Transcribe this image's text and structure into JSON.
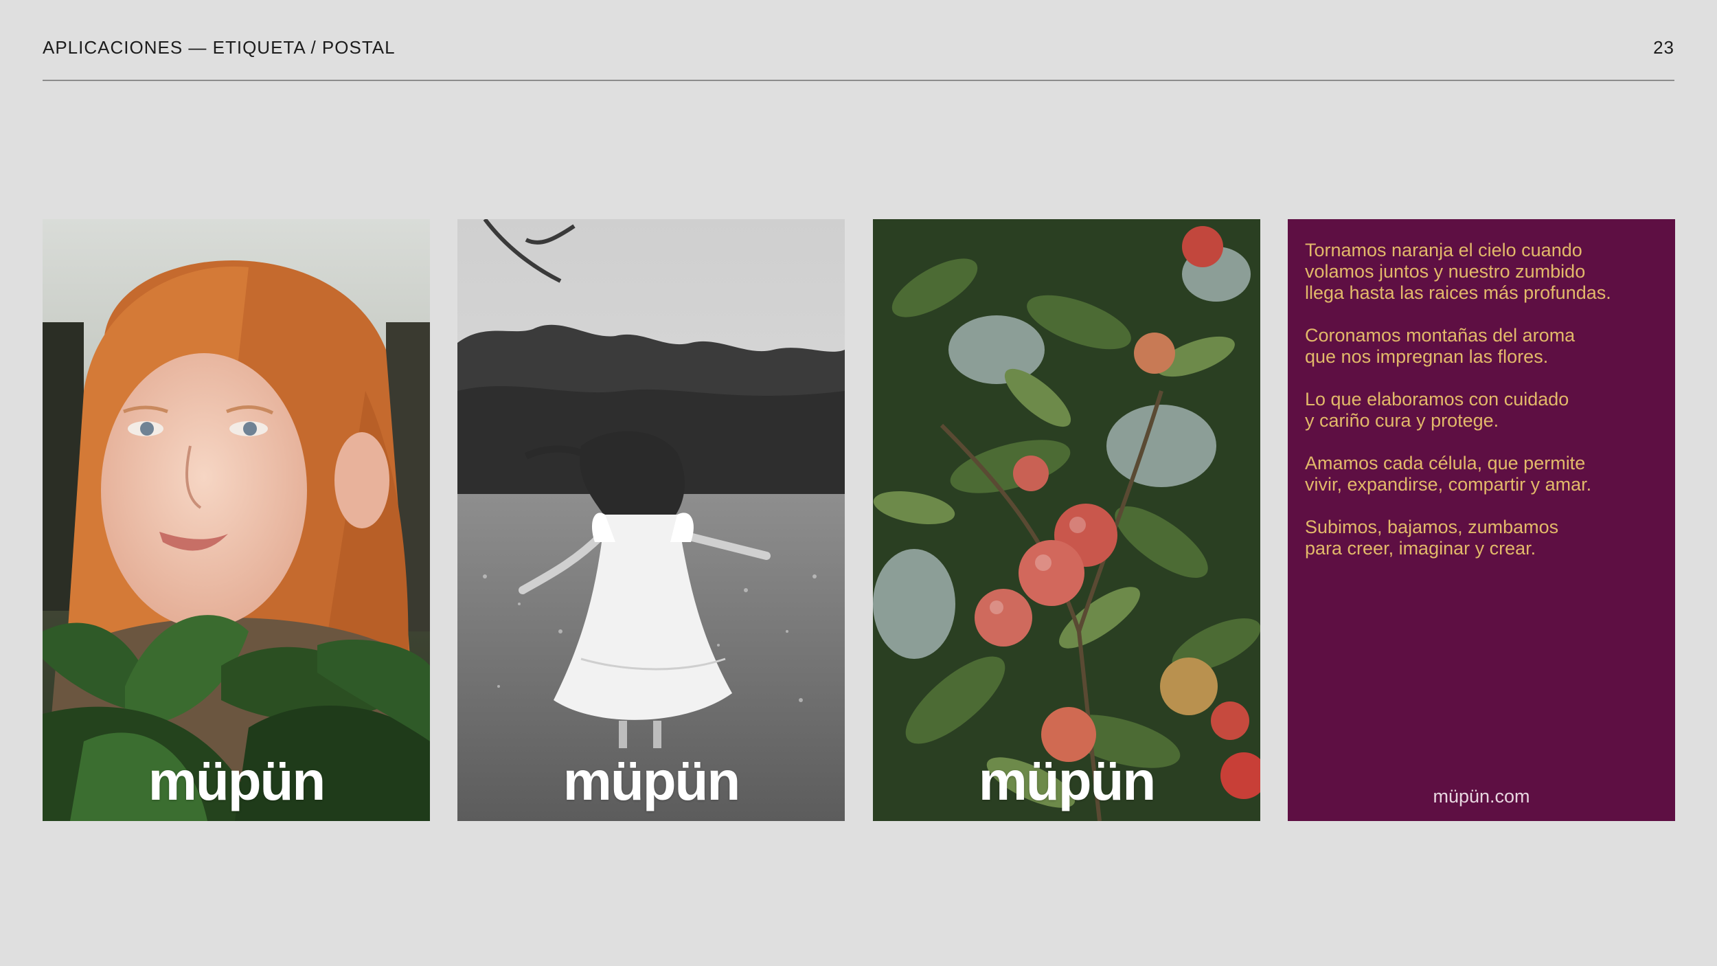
{
  "header": {
    "title": "APLICACIONES — ETIQUETA / POSTAL",
    "page_number": "23"
  },
  "cards": {
    "brand": "müpün",
    "portrait_alt": "",
    "dancer_alt": "",
    "apples_alt": ""
  },
  "text_card": {
    "paragraphs": [
      "Tornamos naranja el cielo cuando\nvolamos juntos y nuestro zumbido\nllega hasta las raices más profundas.",
      "Coronamos montañas del aroma\nque nos impregnan las flores.",
      "Lo que elaboramos con cuidado\ny cariño cura y protege.",
      "Amamos cada célula, que permite\nvivir, expandirse, compartir y amar.",
      "Subimos, bajamos, zumbamos\npara creer, imaginar y crear."
    ],
    "website": "müpün.com"
  },
  "colors": {
    "background": "#dfdfdf",
    "purple_card": "#5e0f43",
    "text_gold": "#e2b96a"
  }
}
